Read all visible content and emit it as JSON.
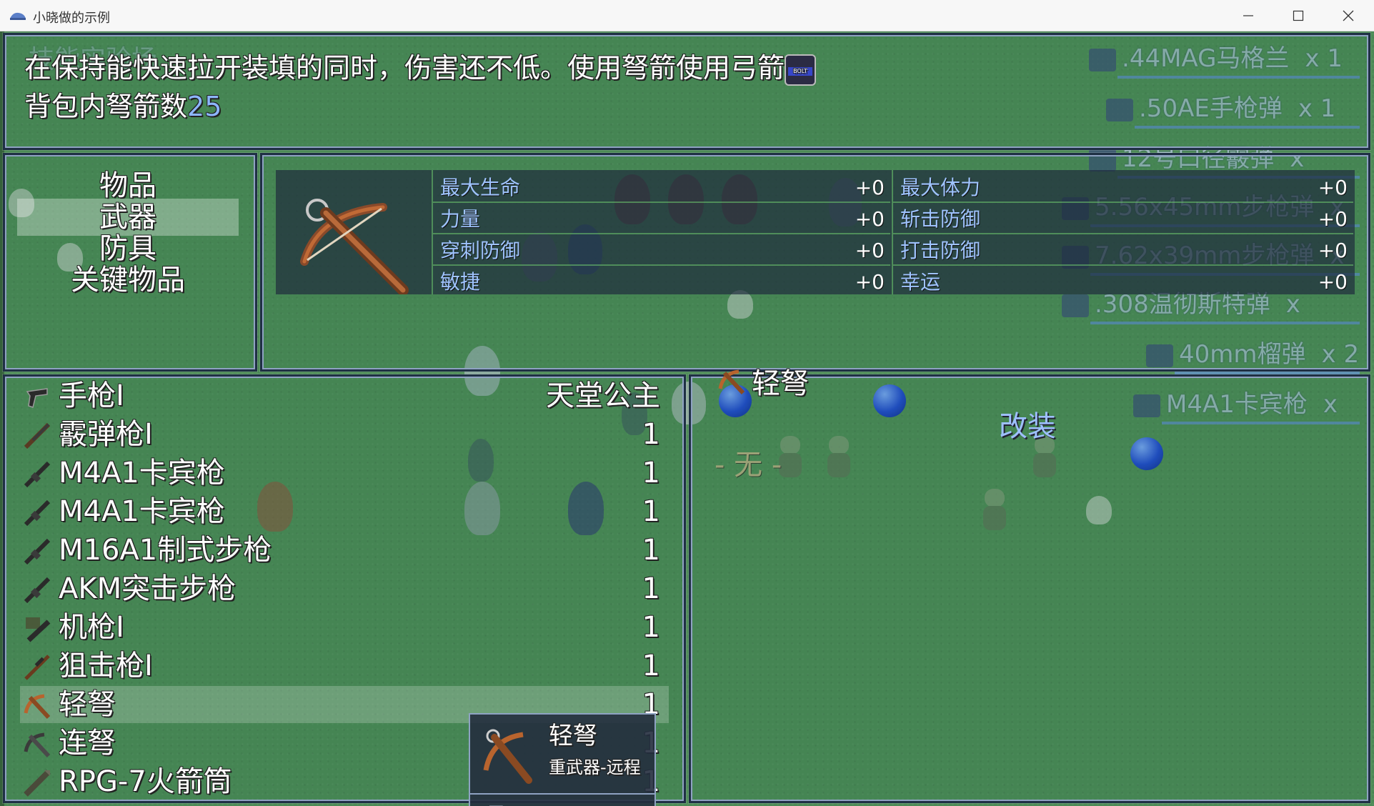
{
  "window": {
    "title": "小晓做的示例"
  },
  "help": {
    "line1": "在保持能快速拉开装填的同时，伤害还不低。使用弩箭使用弓箭",
    "bolt_icon_text": "BOLT",
    "line2_prefix": "背包内弩箭数",
    "line2_count": "25"
  },
  "categories": [
    {
      "label": "物品",
      "selected": false
    },
    {
      "label": "武器",
      "selected": true
    },
    {
      "label": "防具",
      "selected": false
    },
    {
      "label": "关键物品",
      "selected": false
    }
  ],
  "stats": {
    "left": [
      {
        "label": "最大生命",
        "value": "+0"
      },
      {
        "label": "力量",
        "value": "+0"
      },
      {
        "label": "穿刺防御",
        "value": "+0"
      },
      {
        "label": "敏捷",
        "value": "+0"
      }
    ],
    "right": [
      {
        "label": "最大体力",
        "value": "+0"
      },
      {
        "label": "斩击防御",
        "value": "+0"
      },
      {
        "label": "打击防御",
        "value": "+0"
      },
      {
        "label": "幸运",
        "value": "+0"
      }
    ]
  },
  "items": [
    {
      "name": "手枪Ⅰ",
      "count": "天堂公主",
      "icon": "pistol-icon"
    },
    {
      "name": "霰弹枪Ⅰ",
      "count": "1",
      "icon": "shotgun-icon"
    },
    {
      "name": "M4A1卡宾枪",
      "count": "1",
      "icon": "rifle-icon"
    },
    {
      "name": "M4A1卡宾枪",
      "count": "1",
      "icon": "rifle-icon"
    },
    {
      "name": "M16A1制式步枪",
      "count": "1",
      "icon": "rifle-icon"
    },
    {
      "name": "AKM突击步枪",
      "count": "1",
      "icon": "rifle-icon"
    },
    {
      "name": "机枪Ⅰ",
      "count": "1",
      "icon": "machine-gun-icon"
    },
    {
      "name": "狙击枪Ⅰ",
      "count": "1",
      "icon": "sniper-icon"
    },
    {
      "name": "轻弩",
      "count": "1",
      "icon": "crossbow-icon",
      "selected": true
    },
    {
      "name": "连弩",
      "count": "1",
      "icon": "repeating-crossbow-icon"
    },
    {
      "name": "RPG-7火箭筒",
      "count": "1",
      "icon": "rocket-launcher-icon"
    }
  ],
  "tooltip": {
    "name": "轻弩",
    "type": "重武器-远程",
    "slot": "- 无 -"
  },
  "detail": {
    "title": "轻弩",
    "slot": "- 无 -",
    "modify": "改装"
  },
  "ghost_ammo": [
    {
      "name": ".44MAG马格兰",
      "qty": "x 1"
    },
    {
      "name": ".50AE手枪弹",
      "qty": "x 1"
    },
    {
      "name": "12号口径霰弹",
      "qty": "x"
    },
    {
      "name": "5.56x45mm步枪弹",
      "qty": "x"
    },
    {
      "name": "7.62x39mm步枪弹",
      "qty": "x"
    },
    {
      "name": ".308温彻斯特弹",
      "qty": "x"
    },
    {
      "name": "40mm榴弹",
      "qty": "x 2"
    },
    {
      "name": "M4A1卡宾枪",
      "qty": "x"
    }
  ],
  "ghost_header": "技能实验场",
  "colors": {
    "grass": "#4c8a56",
    "window_border": "#1f3044",
    "stat_label": "#9fc4ff",
    "count_blue": "#8db6ff"
  }
}
